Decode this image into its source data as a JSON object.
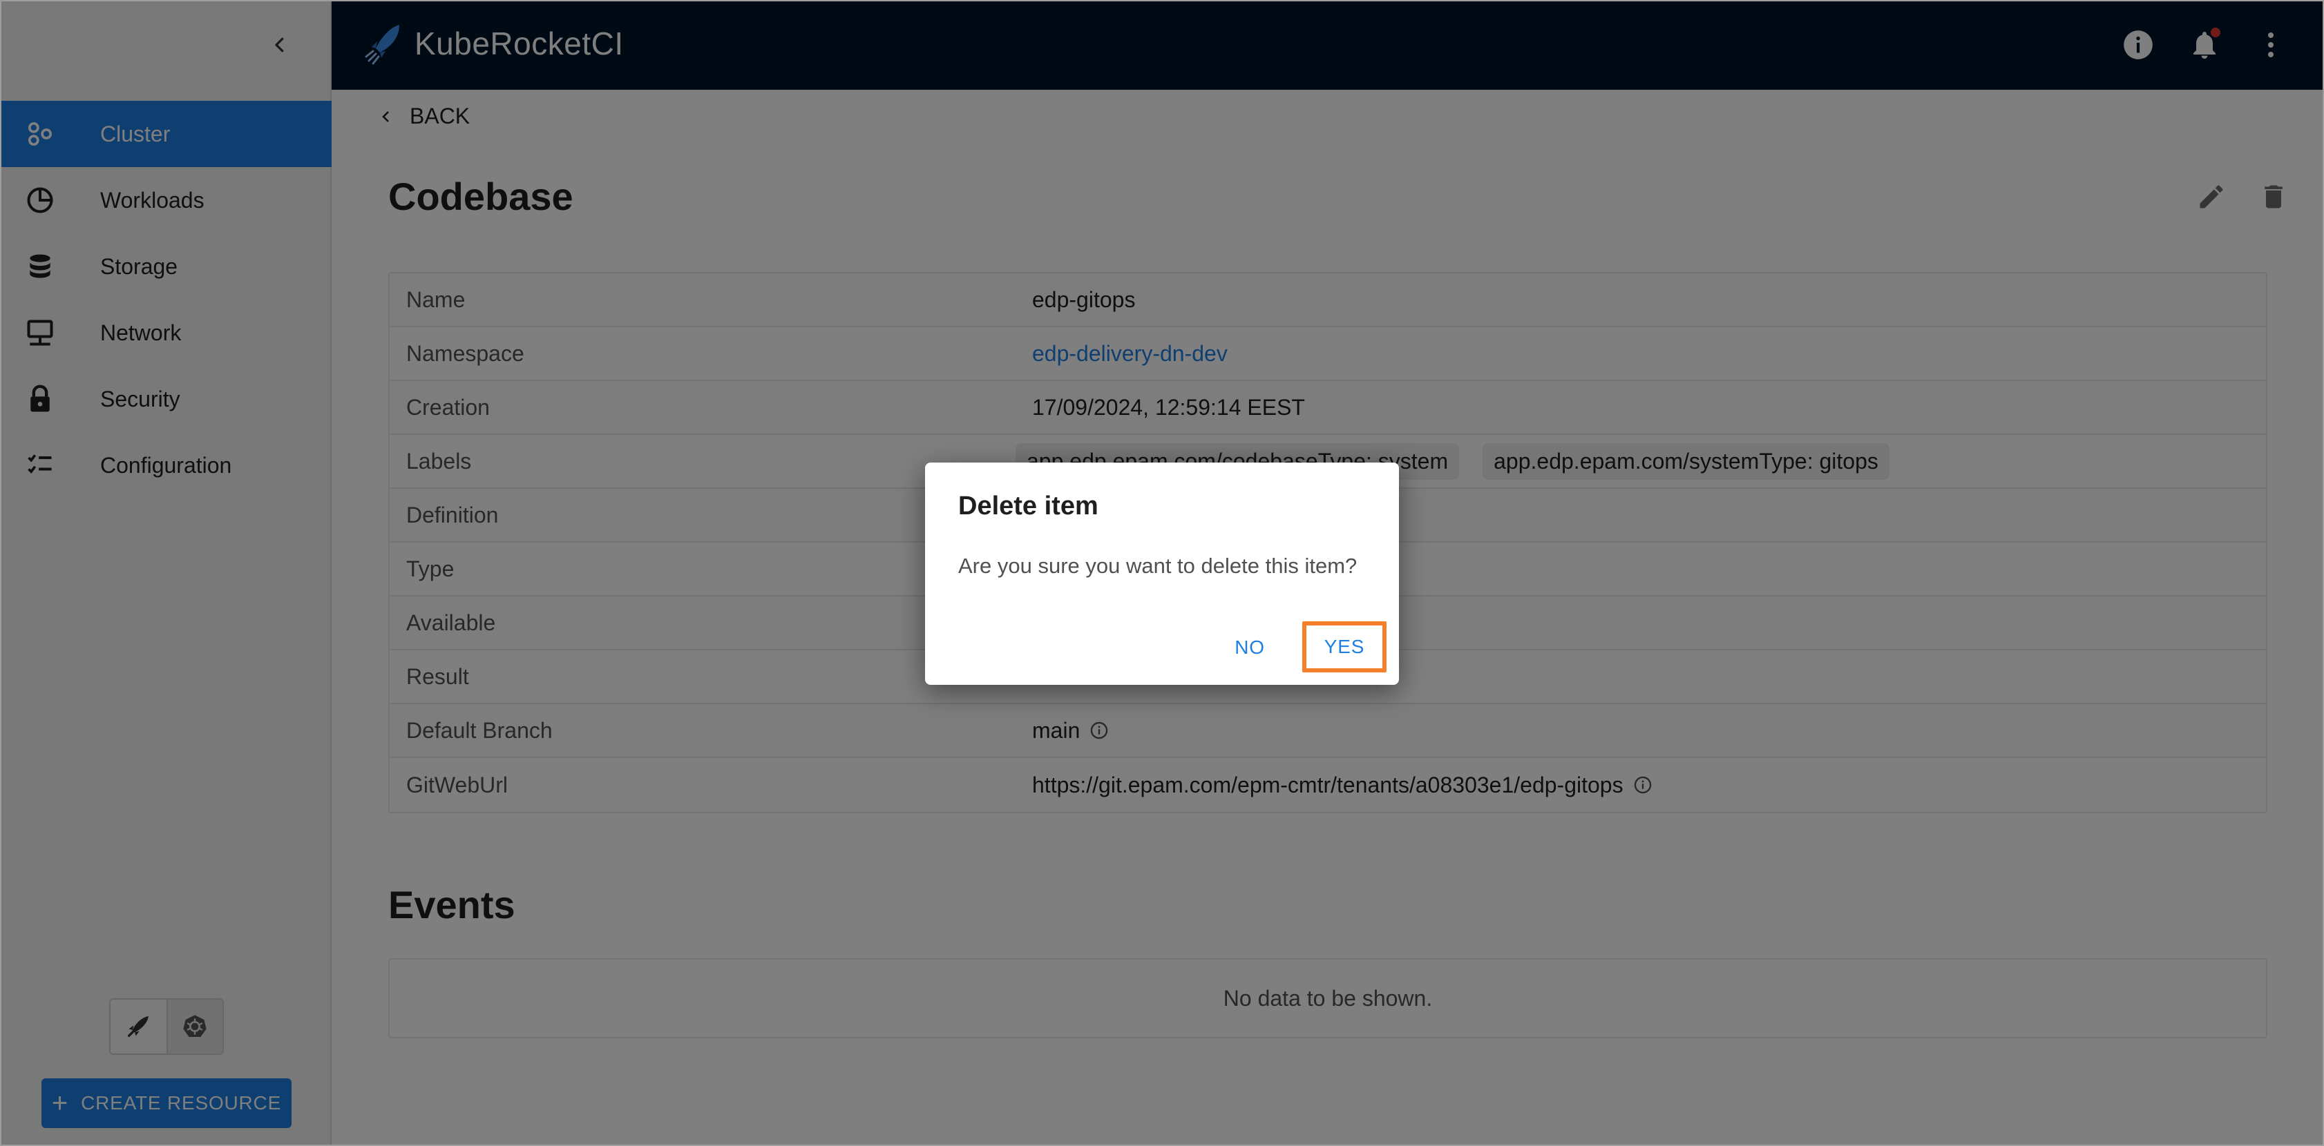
{
  "header": {
    "app_name": "KubeRocketCI",
    "colors": {
      "bar": "#001529",
      "accent": "#1f7fe0"
    }
  },
  "sidebar": {
    "items": [
      {
        "label": "Cluster",
        "icon": "cluster-icon",
        "active": true
      },
      {
        "label": "Workloads",
        "icon": "pie-chart-icon",
        "active": false
      },
      {
        "label": "Storage",
        "icon": "database-icon",
        "active": false
      },
      {
        "label": "Network",
        "icon": "monitor-network-icon",
        "active": false
      },
      {
        "label": "Security",
        "icon": "lock-icon",
        "active": false
      },
      {
        "label": "Configuration",
        "icon": "checklist-icon",
        "active": false
      }
    ],
    "create_resource_label": "CREATE RESOURCE"
  },
  "main": {
    "back_label": "BACK",
    "title": "Codebase",
    "details": [
      {
        "label": "Name",
        "value": "edp-gitops"
      },
      {
        "label": "Namespace",
        "value": "edp-delivery-dn-dev"
      },
      {
        "label": "Creation",
        "value": "17/09/2024, 12:59:14 EEST"
      },
      {
        "label": "Labels",
        "chips": [
          "app.edp.epam.com/codebaseType: system",
          "app.edp.epam.com/systemType: gitops"
        ]
      },
      {
        "label": "Definition",
        "value": ""
      },
      {
        "label": "Type",
        "value": ""
      },
      {
        "label": "Available",
        "value": ""
      },
      {
        "label": "Result",
        "value": ""
      },
      {
        "label": "Default Branch",
        "value": "main"
      },
      {
        "label": "GitWebUrl",
        "value": "https://git.epam.com/epm-cmtr/tenants/a08303e1/edp-gitops"
      }
    ],
    "events_title": "Events",
    "events_empty": "No data to be shown."
  },
  "dialog": {
    "title": "Delete item",
    "message": "Are you sure you want to delete this item?",
    "no_label": "NO",
    "yes_label": "YES",
    "highlight_color": "#f57f2b"
  }
}
